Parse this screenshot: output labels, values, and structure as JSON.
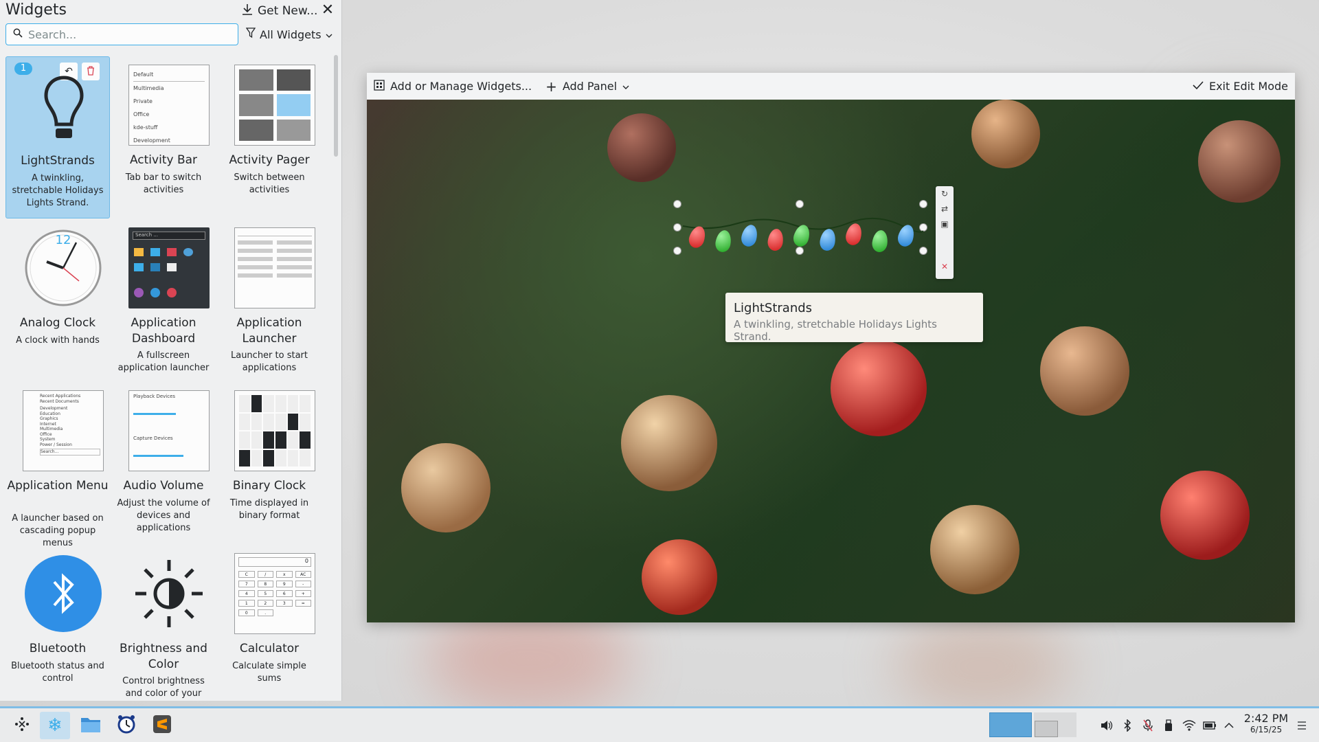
{
  "explorer": {
    "title": "Widgets",
    "get_new_label": "Get New...",
    "search_placeholder": "Search...",
    "filter_label": "All Widgets",
    "widgets": [
      {
        "name": "LightStrands",
        "desc": "A twinkling, stretchable Holidays Lights Strand.",
        "badge": "1"
      },
      {
        "name": "Activity Bar",
        "desc": "Tab bar to switch activities",
        "menu": [
          "Default",
          "Multimedia",
          "Private",
          "Office",
          "kde-stuff",
          "Development"
        ]
      },
      {
        "name": "Activity Pager",
        "desc": "Switch between activities"
      },
      {
        "name": "Analog Clock",
        "desc": "A clock with hands",
        "dial_number": "12"
      },
      {
        "name": "Application Dashboard",
        "desc": "A fullscreen application launcher",
        "search_label": "Search ..."
      },
      {
        "name": "Application Launcher",
        "desc": "Launcher to start applications"
      },
      {
        "name": "Application Menu",
        "desc": "A launcher based on cascading popup menus",
        "menu": [
          "Recent Applications",
          "Recent Documents",
          "Development",
          "Education",
          "Graphics",
          "Internet",
          "Multimedia",
          "Office",
          "System",
          "Power / Session",
          "Search..."
        ]
      },
      {
        "name": "Audio Volume",
        "desc": "Adjust the volume of devices and applications",
        "sections": [
          "Playback Devices",
          "Capture Devices"
        ]
      },
      {
        "name": "Binary Clock",
        "desc": "Time displayed in binary format"
      },
      {
        "name": "Bluetooth",
        "desc": "Bluetooth status and control"
      },
      {
        "name": "Brightness and Color",
        "desc": "Control brightness and color of your"
      },
      {
        "name": "Calculator",
        "desc": "Calculate simple sums",
        "display": "0",
        "keys": [
          "C",
          "/",
          "x",
          "AC",
          "7",
          "8",
          "9",
          "-",
          "4",
          "5",
          "6",
          "+",
          "1",
          "2",
          "3",
          "=",
          "0",
          "."
        ]
      }
    ]
  },
  "edit_toolbar": {
    "add_widgets_label": "Add or Manage Widgets...",
    "add_panel_label": "Add Panel",
    "exit_label": "Exit Edit Mode"
  },
  "tooltip": {
    "title": "LightStrands",
    "desc": "A twinkling, stretchable Holidays Lights Strand."
  },
  "taskbar": {
    "time": "2:42 PM",
    "date": "6/15/25",
    "accent": "#7fbde6"
  },
  "colors": {
    "selection": "#a8d3ef",
    "accent": "#3daee9",
    "bluetooth": "#2f8fe6"
  }
}
